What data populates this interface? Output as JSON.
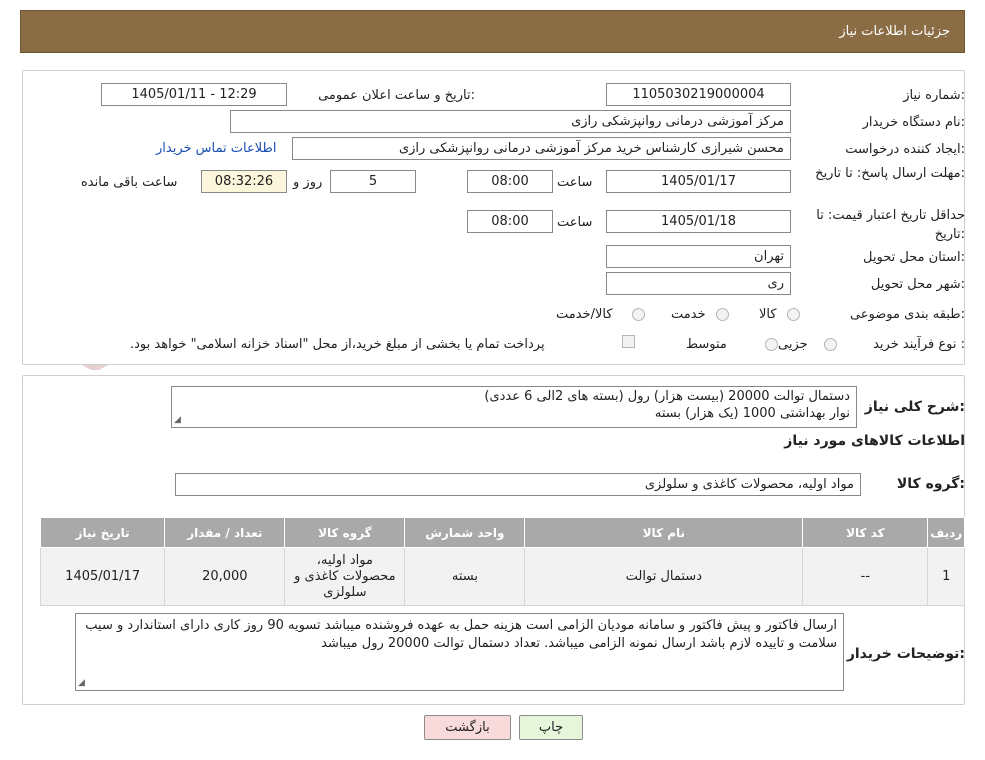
{
  "header": {
    "title": "جزئیات اطلاعات نیاز"
  },
  "watermark": {
    "text": "AriaTender.neT"
  },
  "form": {
    "need_number": {
      "label": "شماره نیاز:",
      "value": "1105030219000004"
    },
    "announce": {
      "label": "تاریخ و ساعت اعلان عمومی:",
      "value": "1405/01/11 - 12:29"
    },
    "buyer_org": {
      "label": "نام دستگاه خریدار:",
      "value": "مرکز آموزشی درمانی روانپزشکی رازی"
    },
    "creator": {
      "label": "ایجاد کننده درخواست:",
      "value": "محسن شیرازی کارشناس خرید مرکز آموزشی درمانی روانپزشکی رازی",
      "contact_link": "اطلاعات تماس خریدار"
    },
    "deadline": {
      "label": "مهلت ارسال پاسخ: تا تاریخ:",
      "date": "1405/01/17",
      "time_label": "ساعت",
      "time": "08:00",
      "days": "5",
      "days_label": "روز و",
      "remaining": "08:32:26",
      "remaining_label": "ساعت باقی مانده"
    },
    "price_validity": {
      "label": "حداقل تاریخ اعتبار قیمت: تا تاریخ:",
      "date": "1405/01/18",
      "time_label": "ساعت",
      "time": "08:00"
    },
    "province": {
      "label": "استان محل تحویل:",
      "value": "تهران"
    },
    "city": {
      "label": "شهر محل تحویل:",
      "value": "ری"
    },
    "category": {
      "label": "طبقه بندی موضوعی:",
      "options": [
        "کالا",
        "خدمت",
        "کالا/خدمت"
      ]
    },
    "process": {
      "label": "نوع فرآیند خرید :",
      "options": [
        "جزیی",
        "متوسط"
      ],
      "payment_note": "پرداخت تمام یا بخشی از مبلغ خرید،از محل \"اسناد خزانه اسلامی\" خواهد بود."
    }
  },
  "summary": {
    "label": "شرح کلی نیاز:",
    "line1": "دستمال توالت 20000 (بیست هزار) رول (بسته های 2الی 6 عددی)",
    "line2": "نوار بهداشتی 1000 (یک هزار) بسته"
  },
  "goods_info": {
    "title": "اطلاعات کالاهای مورد نیاز",
    "group_label": "گروه کالا:",
    "group_value": "مواد اولیه، محصولات کاغذی و سلولزی"
  },
  "table": {
    "headers": [
      "ردیف",
      "کد کالا",
      "نام کالا",
      "واحد شمارش",
      "گروه کالا",
      "تعداد / مقدار",
      "تاریخ نیاز"
    ],
    "rows": [
      [
        "1",
        "--",
        "دستمال توالت",
        "بسته",
        "مواد اولیه، محصولات کاغذی و سلولزی",
        "20,000",
        "1405/01/17"
      ]
    ]
  },
  "buyer_notes": {
    "label": "توضیحات خریدار:",
    "text": "ارسال فاکتور و پیش فاکتور و سامانه مودیان الزامی است هزینه حمل به عهده فروشنده میباشد تسویه 90 روز کاری دارای استاندارد و سیب سلامت و تاییده لازم باشد ارسال نمونه الزامی میباشد. تعداد دستمال توالت 20000 رول میباشد"
  },
  "buttons": {
    "print": "چاپ",
    "back": "بازگشت"
  },
  "colors": {
    "header_bg": "#8b6d45",
    "table_header": "#a9a9a9",
    "back_button": "#f8dada",
    "print_button": "#e6f6da",
    "link": "#1a4fb5"
  }
}
